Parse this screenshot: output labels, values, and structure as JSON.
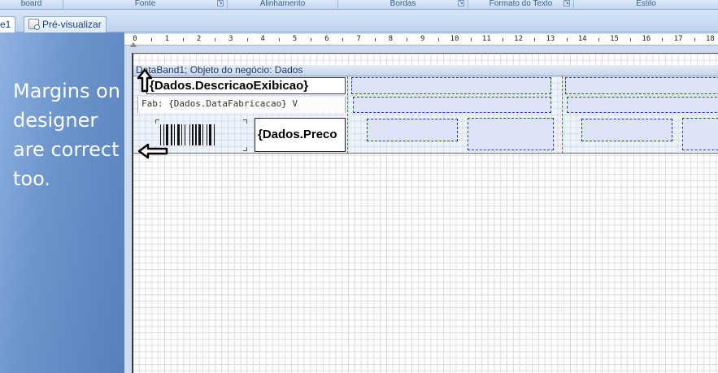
{
  "ribbon": {
    "groups": [
      {
        "label": "board",
        "launcher": false
      },
      {
        "label": "Fonte",
        "launcher": true
      },
      {
        "label": "Alinhamento",
        "launcher": false
      },
      {
        "label": "Bordas",
        "launcher": true
      },
      {
        "label": "Formato do Texto",
        "launcher": true
      },
      {
        "label": "Estilo",
        "launcher": false
      }
    ]
  },
  "tabs": [
    {
      "label": "e1",
      "active": true
    },
    {
      "label": "Pré-visualizar",
      "active": false,
      "icon": "preview-icon"
    }
  ],
  "annotation": {
    "text": "Margins on designer are correct too."
  },
  "ruler": {
    "numbers": [
      "0",
      "1",
      "2",
      "3",
      "4",
      "5",
      "6",
      "7",
      "8",
      "9",
      "10",
      "11",
      "12",
      "13",
      "14",
      "15",
      "16",
      "17",
      "18"
    ]
  },
  "band": {
    "header": "DataBand1; Objeto do negócio: Dados",
    "fields": {
      "descricao": "{Dados.DescricaoExibicao}",
      "fabricacao": "Fab: {Dados.DataFabricacao}  V",
      "preco": "{Dados.Preco"
    }
  },
  "colors": {
    "panel": "#5d86bd",
    "grid": "#dcdcdc",
    "placeholder_border": "#1e3cc8",
    "placeholder_fill": "#dee4f7",
    "margin_line": "#e03030"
  }
}
